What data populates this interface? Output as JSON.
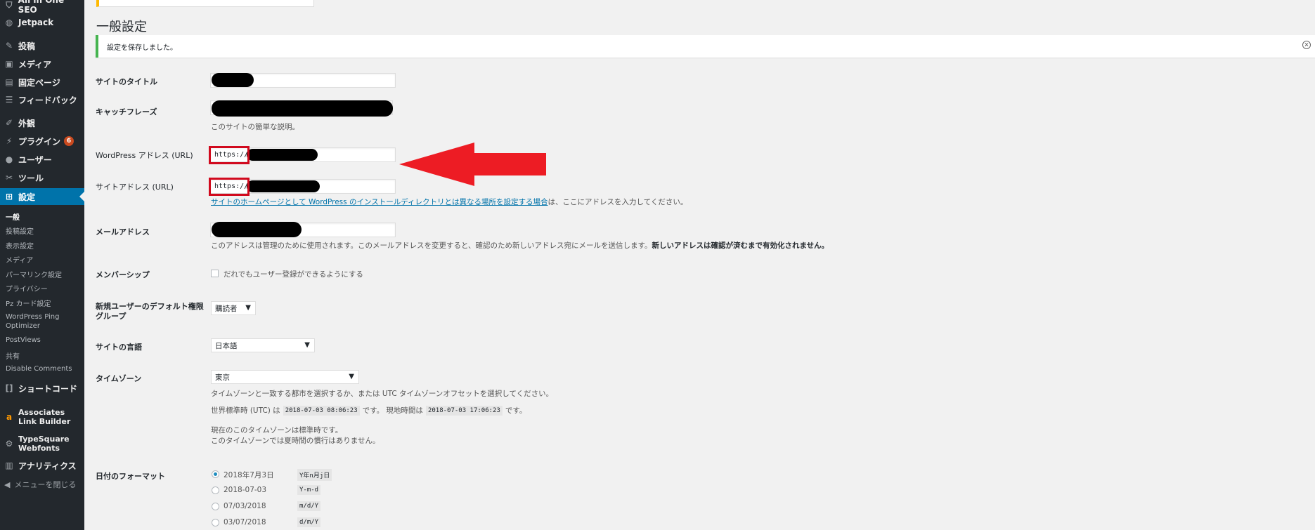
{
  "sidebar": {
    "items": [
      {
        "label": "All in One SEO",
        "icon": "shield-icon"
      },
      {
        "label": "Jetpack",
        "icon": "jetpack-icon"
      },
      {
        "label": "投稿",
        "icon": "pin-icon"
      },
      {
        "label": "メディア",
        "icon": "media-icon"
      },
      {
        "label": "固定ページ",
        "icon": "page-icon"
      },
      {
        "label": "フィードバック",
        "icon": "feedback-icon"
      },
      {
        "label": "外観",
        "icon": "brush-icon"
      },
      {
        "label": "プラグイン",
        "icon": "plugin-icon",
        "badge": "6"
      },
      {
        "label": "ユーザー",
        "icon": "user-icon"
      },
      {
        "label": "ツール",
        "icon": "wrench-icon"
      },
      {
        "label": "設定",
        "icon": "settings-icon"
      }
    ],
    "submenu": [
      "一般",
      "投稿設定",
      "表示設定",
      "メディア",
      "パーマリンク設定",
      "プライバシー",
      "Pz カード設定",
      "WordPress Ping Optimizer",
      "PostViews",
      "共有",
      "Disable Comments"
    ],
    "items_after": [
      {
        "label": "ショートコード",
        "icon": "shortcode-icon"
      },
      {
        "label": "Associates Link Builder",
        "icon": "amazon-icon"
      },
      {
        "label": "TypeSquare Webfonts",
        "icon": "gear-icon"
      },
      {
        "label": "アナリティクス",
        "icon": "chart-icon"
      }
    ],
    "collapse_label": "メニューを閉じる"
  },
  "page": {
    "title": "一般設定",
    "notice": "設定を保存しました。"
  },
  "fields": {
    "site_title_label": "サイトのタイトル",
    "tagline_label": "キャッチフレーズ",
    "tagline_desc": "このサイトの簡単な説明。",
    "wp_address_label": "WordPress アドレス (URL)",
    "wp_address_value": "https://",
    "site_address_label": "サイトアドレス (URL)",
    "site_address_value": "https://",
    "site_address_desc_link": "サイトのホームページとして WordPress のインストールディレクトリとは異なる場所を設定する場合",
    "site_address_desc_rest": "は、ここにアドレスを入力してください。",
    "email_label": "メールアドレス",
    "email_desc": "このアドレスは管理のために使用されます。このメールアドレスを変更すると、確認のため新しいアドレス宛にメールを送信します。",
    "email_desc_bold": "新しいアドレスは確認が済むまで有効化されません。",
    "membership_label": "メンバーシップ",
    "membership_checkbox": "だれでもユーザー登録ができるようにする",
    "default_role_label_1": "新規ユーザーのデフォルト権限",
    "default_role_label_2": "グループ",
    "default_role_value": "購読者",
    "language_label": "サイトの言語",
    "language_value": "日本語",
    "timezone_label": "タイムゾーン",
    "timezone_value": "東京",
    "timezone_desc": "タイムゾーンと一致する都市を選択するか、または UTC タイムゾーンオフセットを選択してください。",
    "utc_prefix": "世界標準時 (UTC) は",
    "utc_time": "2018-07-03 08:06:23",
    "local_prefix": "です。 現地時間は",
    "local_time": "2018-07-03 17:06:23",
    "local_suffix": "です。",
    "dst_line1": "現在のこのタイムゾーンは標準時です。",
    "dst_line2": "このタイムゾーンでは夏時間の慣行はありません。",
    "date_format_label": "日付のフォーマット",
    "date_formats": [
      {
        "label": "2018年7月3日",
        "code": "Y年n月j日"
      },
      {
        "label": "2018-07-03",
        "code": "Y-m-d"
      },
      {
        "label": "07/03/2018",
        "code": "m/d/Y"
      },
      {
        "label": "03/07/2018",
        "code": "d/m/Y"
      }
    ]
  },
  "colors": {
    "accent": "#0073aa",
    "annotation_red": "#ed1c24",
    "notice_green": "#46b450"
  }
}
